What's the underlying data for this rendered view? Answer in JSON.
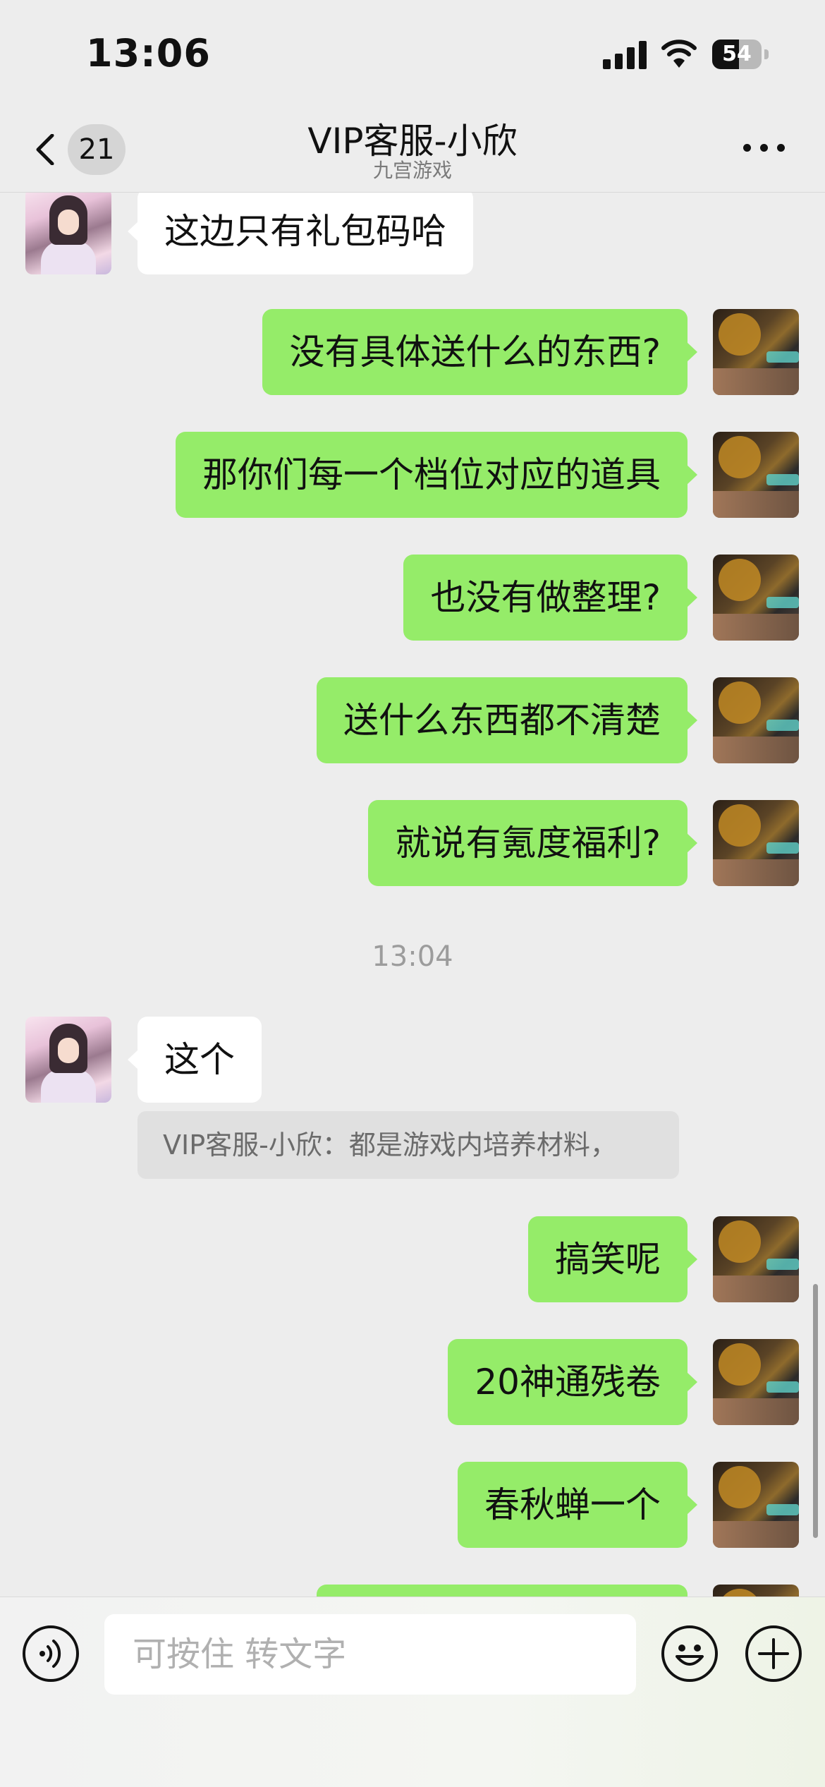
{
  "status_bar": {
    "time": "13:06",
    "battery_level": "54",
    "battery_percent": 54,
    "icons": [
      "cellular-signal-icon",
      "wifi-icon",
      "battery-icon"
    ]
  },
  "nav": {
    "back_icon": "chevron-left-icon",
    "unread_count": "21",
    "title": "VIP客服-小欣",
    "subtitle": "九宫游戏",
    "more_icon": "ellipsis-icon"
  },
  "messages": [
    {
      "from": "agent",
      "text": "这边只有礼包码哈"
    },
    {
      "from": "me",
      "text": "没有具体送什么的东西?"
    },
    {
      "from": "me",
      "text": "那你们每一个档位对应的道具"
    },
    {
      "from": "me",
      "text": "也没有做整理?"
    },
    {
      "from": "me",
      "text": "送什么东西都不清楚"
    },
    {
      "from": "me",
      "text": "就说有氪度福利?"
    },
    {
      "type": "timestamp",
      "text": "13:04"
    },
    {
      "from": "agent",
      "text": "这个",
      "quote": "VIP客服-小欣：都是游戏内培养材料，"
    },
    {
      "from": "me",
      "text": "搞笑呢"
    },
    {
      "from": "me",
      "text": "20神通残卷"
    },
    {
      "from": "me",
      "text": "春秋蝉一个"
    }
  ],
  "input_bar": {
    "voice_icon": "voice-icon",
    "placeholder": "可按住 转文字",
    "emoji_icon": "emoji-icon",
    "plus_icon": "plus-icon"
  },
  "colors": {
    "background": "#ededed",
    "outgoing_bubble": "#95ec69",
    "incoming_bubble": "#ffffff"
  }
}
